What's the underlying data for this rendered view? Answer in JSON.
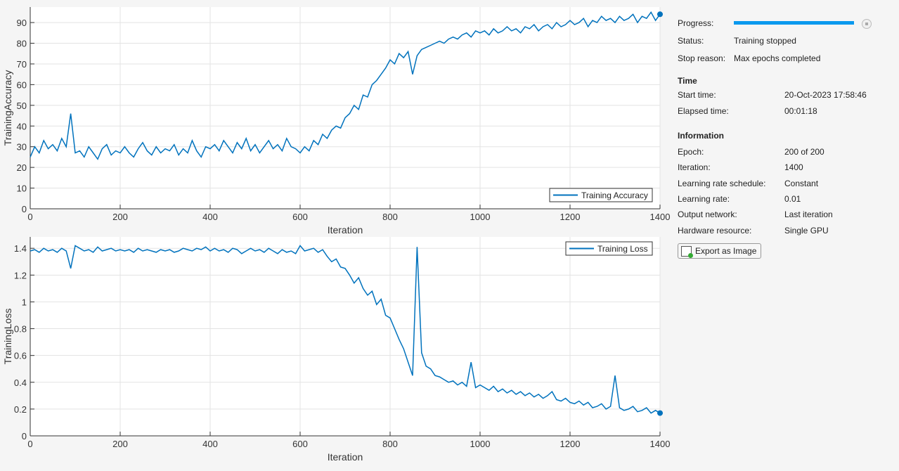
{
  "panel": {
    "progress_label": "Progress:",
    "progress": 1.0,
    "status_label": "Status:",
    "status": "Training stopped",
    "stop_reason_label": "Stop reason:",
    "stop_reason": "Max epochs completed",
    "time_header": "Time",
    "start_time_label": "Start time:",
    "start_time": "20-Oct-2023 17:58:46",
    "elapsed_label": "Elapsed time:",
    "elapsed": "00:01:18",
    "info_header": "Information",
    "info": [
      {
        "label": "Epoch:",
        "value": "200 of 200"
      },
      {
        "label": "Iteration:",
        "value": "1400"
      },
      {
        "label": "Learning rate schedule:",
        "value": "Constant"
      },
      {
        "label": "Learning rate:",
        "value": "0.01"
      },
      {
        "label": "Output network:",
        "value": "Last iteration"
      },
      {
        "label": "Hardware resource:",
        "value": "Single GPU"
      }
    ],
    "export_label": "Export as Image",
    "stop_icon": "stop-icon",
    "export_icon": "export-image-icon"
  },
  "chart_data": [
    {
      "type": "line",
      "xlabel": "Iteration",
      "ylabel": "TrainingAccuracy",
      "xlim": [
        0,
        1400
      ],
      "ylim": [
        0,
        97.5
      ],
      "xticks": [
        0,
        200,
        400,
        600,
        800,
        1000,
        1200,
        1400
      ],
      "yticks": [
        0,
        10,
        20,
        30,
        40,
        50,
        60,
        70,
        80,
        90
      ],
      "grid": true,
      "legend": "bottom-right",
      "color": "#0072bd",
      "x_step": 10,
      "series": [
        {
          "name": "Training Accuracy",
          "values": [
            25,
            30,
            27,
            33,
            29,
            31,
            28,
            34,
            30,
            46,
            27,
            28,
            25,
            30,
            27,
            24,
            29,
            31,
            26,
            28,
            27,
            30,
            27,
            25,
            29,
            32,
            28,
            26,
            30,
            27,
            29,
            28,
            31,
            26,
            29,
            27,
            33,
            28,
            25,
            30,
            29,
            31,
            28,
            33,
            30,
            27,
            32,
            29,
            34,
            28,
            31,
            27,
            30,
            33,
            29,
            31,
            28,
            34,
            30,
            29,
            27,
            30,
            28,
            33,
            31,
            36,
            34,
            38,
            40,
            39,
            44,
            46,
            50,
            48,
            55,
            54,
            60,
            62,
            65,
            68,
            72,
            70,
            75,
            73,
            76,
            65,
            74,
            77,
            78,
            79,
            80,
            81,
            80,
            82,
            83,
            82,
            84,
            85,
            83,
            86,
            85,
            86,
            84,
            87,
            85,
            86,
            88,
            86,
            87,
            85,
            88,
            87,
            89,
            86,
            88,
            89,
            87,
            90,
            88,
            89,
            91,
            89,
            90,
            92,
            88,
            91,
            90,
            93,
            91,
            92,
            90,
            93,
            91,
            92,
            94,
            90,
            93,
            92,
            95,
            91,
            94
          ]
        }
      ]
    },
    {
      "type": "line",
      "xlabel": "Iteration",
      "ylabel": "TrainingLoss",
      "xlim": [
        0,
        1400
      ],
      "ylim": [
        0,
        1.485
      ],
      "xticks": [
        0,
        200,
        400,
        600,
        800,
        1000,
        1200,
        1400
      ],
      "yticks": [
        0,
        0.2,
        0.4,
        0.6,
        0.8,
        1,
        1.2,
        1.4
      ],
      "grid": true,
      "legend": "top-right",
      "color": "#0072bd",
      "x_step": 10,
      "series": [
        {
          "name": "Training Loss",
          "values": [
            1.38,
            1.39,
            1.37,
            1.4,
            1.38,
            1.39,
            1.37,
            1.4,
            1.38,
            1.25,
            1.42,
            1.4,
            1.38,
            1.39,
            1.37,
            1.41,
            1.38,
            1.39,
            1.4,
            1.38,
            1.39,
            1.38,
            1.39,
            1.37,
            1.4,
            1.38,
            1.39,
            1.38,
            1.37,
            1.39,
            1.38,
            1.39,
            1.37,
            1.38,
            1.4,
            1.39,
            1.38,
            1.4,
            1.39,
            1.41,
            1.38,
            1.4,
            1.38,
            1.39,
            1.37,
            1.4,
            1.39,
            1.36,
            1.38,
            1.4,
            1.38,
            1.39,
            1.37,
            1.4,
            1.38,
            1.36,
            1.39,
            1.37,
            1.38,
            1.36,
            1.42,
            1.38,
            1.39,
            1.4,
            1.37,
            1.39,
            1.34,
            1.3,
            1.32,
            1.26,
            1.25,
            1.2,
            1.14,
            1.18,
            1.1,
            1.05,
            1.08,
            0.98,
            1.02,
            0.9,
            0.88,
            0.8,
            0.72,
            0.65,
            0.55,
            0.45,
            1.41,
            0.62,
            0.52,
            0.5,
            0.45,
            0.44,
            0.42,
            0.4,
            0.41,
            0.38,
            0.4,
            0.37,
            0.55,
            0.36,
            0.38,
            0.36,
            0.34,
            0.37,
            0.33,
            0.35,
            0.32,
            0.34,
            0.31,
            0.33,
            0.3,
            0.32,
            0.29,
            0.31,
            0.28,
            0.3,
            0.33,
            0.27,
            0.26,
            0.28,
            0.25,
            0.24,
            0.26,
            0.23,
            0.25,
            0.21,
            0.22,
            0.24,
            0.2,
            0.22,
            0.45,
            0.21,
            0.19,
            0.2,
            0.22,
            0.18,
            0.19,
            0.21,
            0.17,
            0.19,
            0.17
          ]
        }
      ]
    }
  ]
}
